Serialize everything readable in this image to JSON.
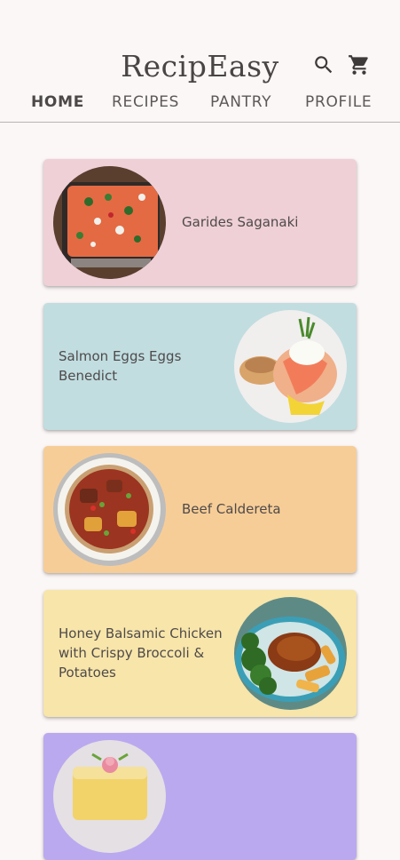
{
  "header": {
    "title": "RecipEasy",
    "search_icon": "search-icon",
    "cart_icon": "shopping-cart-icon"
  },
  "tabs": [
    {
      "label": "HOME",
      "active": true
    },
    {
      "label": "RECIPES",
      "active": false
    },
    {
      "label": "PANTRY",
      "active": false
    },
    {
      "label": "PROFILE",
      "active": false
    }
  ],
  "recipes": [
    {
      "name": "Garides Saganaki",
      "color": "#efd0d7"
    },
    {
      "name": "Salmon Eggs Eggs Benedict",
      "color": "#c1dde0"
    },
    {
      "name": "Beef Caldereta",
      "color": "#f7cd97"
    },
    {
      "name": "Honey Balsamic Chicken with Crispy Broccoli & Potatoes",
      "color": "#f7e5aa"
    },
    {
      "name": "",
      "color": "#bba9ef"
    }
  ]
}
